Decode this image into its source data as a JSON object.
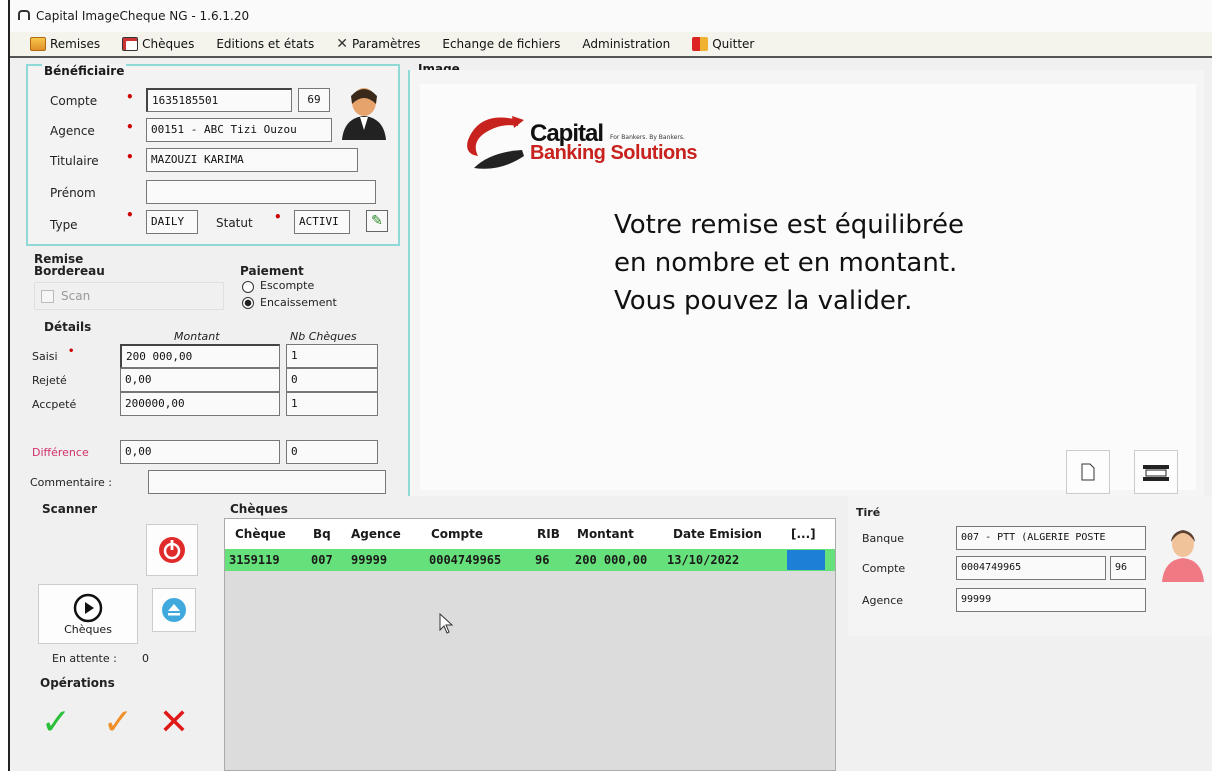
{
  "window": {
    "title": "Capital ImageCheque NG - 1.6.1.20"
  },
  "menu": {
    "items": [
      "Remises",
      "Chèques",
      "Editions et états",
      "Paramètres",
      "Echange de fichiers",
      "Administration",
      "Quitter"
    ]
  },
  "beneficiaire": {
    "title": "Bénéficiaire",
    "compte_label": "Compte",
    "compte_value": "1635185501",
    "compte_key": "69",
    "agence_label": "Agence",
    "agence_value": "00151 - ABC Tizi Ouzou",
    "titulaire_label": "Titulaire",
    "titulaire_value": "MAZOUZI KARIMA",
    "prenom_label": "Prénom",
    "prenom_value": "",
    "type_label": "Type",
    "type_value": "DAILY",
    "statut_label": "Statut",
    "statut_value": "ACTIVI"
  },
  "remise": {
    "title": "Remise",
    "bordereau_label": "Bordereau",
    "scan_label": "Scan",
    "paiement_label": "Paiement",
    "escompte_label": "Escompte",
    "encaissement_label": "Encaissement",
    "details_label": "Détails",
    "col_montant": "Montant",
    "col_nb": "Nb Chèques",
    "saisi_label": "Saisi",
    "saisi_montant": "200 000,00",
    "saisi_nb": "1",
    "rejete_label": "Rejeté",
    "rejete_montant": "0,00",
    "rejete_nb": "0",
    "accepte_label": "Accpeté",
    "accepte_montant": "200000,00",
    "accepte_nb": "1",
    "difference_label": "Différence",
    "difference_montant": "0,00",
    "difference_nb": "0",
    "commentaire_label": "Commentaire :",
    "commentaire_value": ""
  },
  "image": {
    "title": "Image",
    "logo_line1": "Capital",
    "logo_tagline": "For Bankers. By Bankers.",
    "logo_line2": "Banking Solutions",
    "message": [
      "Votre remise est équilibrée",
      "en nombre et en montant.",
      "Vous pouvez la valider."
    ]
  },
  "scanner": {
    "title": "Scanner",
    "cheques_button": "Chèques",
    "en_attente_label": "En attente :",
    "en_attente_value": "0"
  },
  "operations": {
    "title": "Opérations"
  },
  "cheques": {
    "title": "Chèques",
    "columns": [
      "Chèque",
      "Bq",
      "Agence",
      "Compte",
      "RIB",
      "Montant",
      "Date Emision",
      "[...]"
    ],
    "rows": [
      {
        "cheque": "3159119",
        "bq": "007",
        "agence": "99999",
        "compte": "0004749965",
        "rib": "96",
        "montant": "200 000,00",
        "date": "13/10/2022"
      }
    ]
  },
  "tire": {
    "title": "Tiré",
    "banque_label": "Banque",
    "banque_value": "007 - PTT (ALGERIE POSTE",
    "compte_label": "Compte",
    "compte_value": "0004749965",
    "compte_key": "96",
    "agence_label": "Agence",
    "agence_value": "99999"
  },
  "colors": {
    "accent_border": "#8fd9d6",
    "row_selected": "#66e07a",
    "required": "#cc0000",
    "difference_label": "#d0306a"
  }
}
